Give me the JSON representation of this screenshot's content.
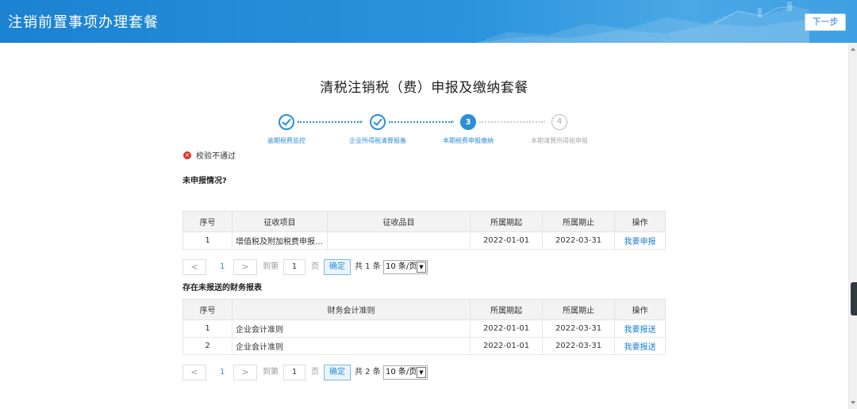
{
  "header": {
    "title": "注销前置事项办理套餐",
    "next_label": "下一步"
  },
  "page_title": "清税注销税（费）申报及缴纳套餐",
  "steps": [
    {
      "label": "逾期税费监控",
      "state": "done",
      "marker": ""
    },
    {
      "label": "企业所得税清算报备",
      "state": "done",
      "marker": ""
    },
    {
      "label": "本期税费申报缴纳",
      "state": "active",
      "marker": "3"
    },
    {
      "label": "本期清算所得税申报",
      "state": "todo",
      "marker": "4"
    }
  ],
  "section1": {
    "title": "未申报情况?",
    "status_text": "校验不通过",
    "columns": [
      "序号",
      "征收项目",
      "征收品目",
      "所属期起",
      "所属期止",
      "操作"
    ],
    "rows": [
      [
        "1",
        "增值税及附加税费申报表...",
        "",
        "2022-01-01",
        "2022-03-31",
        "我要申报"
      ]
    ],
    "pager": {
      "prev": "<",
      "page": "1",
      "next": ">",
      "goto_label": "到第",
      "page_input": "1",
      "page_unit": "页",
      "confirm": "确定",
      "total": "共 1 条",
      "page_size": "10 条/页"
    }
  },
  "section2": {
    "title": "存在未报送的财务报表",
    "columns": [
      "序号",
      "财务会计准则",
      "所属期起",
      "所属期止",
      "操作"
    ],
    "rows": [
      [
        "1",
        "企业会计准则",
        "2022-01-01",
        "2022-03-31",
        "我要报送"
      ],
      [
        "2",
        "企业会计准则",
        "2022-01-01",
        "2022-03-31",
        "我要报送"
      ]
    ],
    "pager": {
      "prev": "<",
      "page": "1",
      "next": ">",
      "goto_label": "到第",
      "page_input": "1",
      "page_unit": "页",
      "confirm": "确定",
      "total": "共 2 条",
      "page_size": "10 条/页"
    }
  },
  "icons": {
    "check": "check-icon",
    "error": "error-circle-icon"
  },
  "colors": {
    "header": "#1b82d2",
    "accent": "#2b8fd6",
    "link": "#1e7fd0",
    "error": "#e0352b"
  }
}
